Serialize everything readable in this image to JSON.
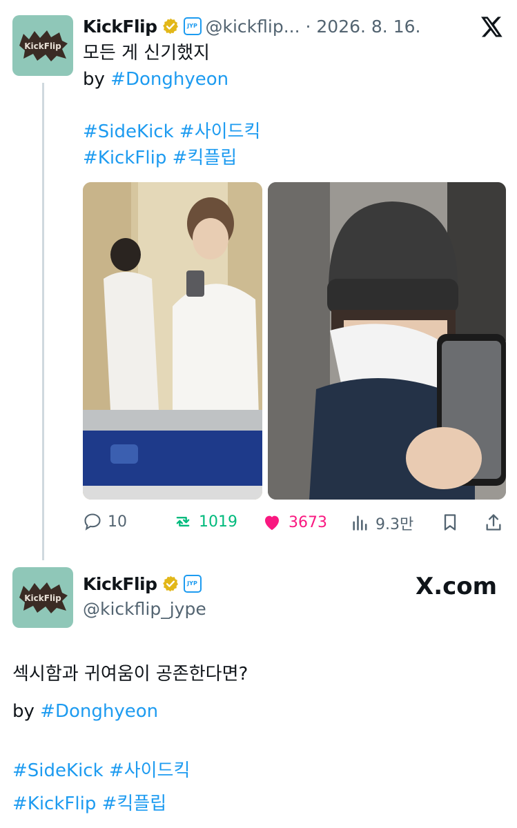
{
  "tweet1": {
    "author_name": "KickFlip",
    "handle_and_date": "@kickflip... · 2026. 8. 16.",
    "badge": "JYP",
    "line1": "모든 게 신기했지",
    "by_prefix": "by ",
    "by_tag": "#Donghyeon",
    "tags_line1": "#SideKick #사이드킥",
    "tags_line2": "#KickFlip #킥플립",
    "stats": {
      "replies": "10",
      "retweets": "1019",
      "likes": "3673",
      "views": "9.3만"
    }
  },
  "tweet2": {
    "author_name": "KickFlip",
    "handle": "@kickflip_jype",
    "badge": "JYP",
    "watermark": "X.com",
    "line1": "섹시함과 귀여움이 공존한다면?",
    "by_prefix": "by ",
    "by_tag": "#Donghyeon",
    "tags_line1": "#SideKick #사이드킥",
    "tags_line2": "#KickFlip #킥플립"
  },
  "avatar_text": "KickFlip",
  "colors": {
    "accent": "#1d9bf0",
    "retweet": "#00ba7c",
    "like": "#f91880",
    "avatar_bg": "#8fc7b8"
  }
}
